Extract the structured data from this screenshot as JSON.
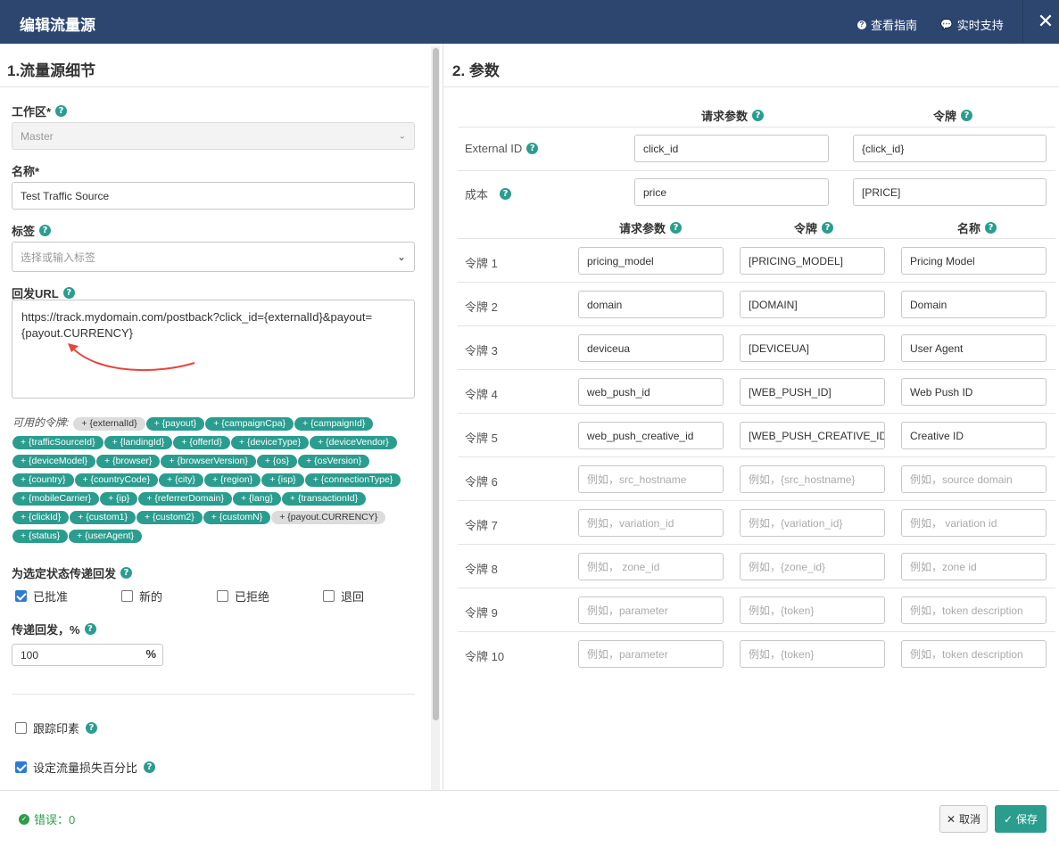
{
  "header": {
    "title": "编辑流量源",
    "guide_label": "查看指南",
    "support_label": "实时支持",
    "close_label": "✕"
  },
  "left": {
    "section_title": "1.流量源细节",
    "workspace": {
      "label": "工作区*",
      "value": "Master"
    },
    "name": {
      "label": "名称*",
      "value": "Test Traffic Source"
    },
    "tags": {
      "label": "标签",
      "placeholder": "选择或输入标签"
    },
    "postback": {
      "label": "回发URL",
      "line1": "https://track.mydomain.com/postback?click_id={externalId}&payout=",
      "line2": "{payout.CURRENCY}"
    },
    "tokens_label": "可用的令牌:",
    "tokens": [
      {
        "t": "+ {externalId}",
        "used": true
      },
      {
        "t": "+ {payout}"
      },
      {
        "t": "+ {campaignCpa}"
      },
      {
        "t": "+ {campaignId}"
      },
      {
        "t": "+ {trafficSourceId}"
      },
      {
        "t": "+ {landingId}"
      },
      {
        "t": "+ {offerId}"
      },
      {
        "t": "+ {deviceType}"
      },
      {
        "t": "+ {deviceVendor}"
      },
      {
        "t": "+ {deviceModel}"
      },
      {
        "t": "+ {browser}"
      },
      {
        "t": "+ {browserVersion}"
      },
      {
        "t": "+ {os}"
      },
      {
        "t": "+ {osVersion}"
      },
      {
        "t": "+ {country}"
      },
      {
        "t": "+ {countryCode}"
      },
      {
        "t": "+ {city}"
      },
      {
        "t": "+ {region}"
      },
      {
        "t": "+ {isp}"
      },
      {
        "t": "+ {connectionType}"
      },
      {
        "t": "+ {mobileCarrier}"
      },
      {
        "t": "+ {ip}"
      },
      {
        "t": "+ {referrerDomain}"
      },
      {
        "t": "+ {lang}"
      },
      {
        "t": "+ {transactionId}"
      },
      {
        "t": "+ {clickId}"
      },
      {
        "t": "+ {custom1}"
      },
      {
        "t": "+ {custom2}"
      },
      {
        "t": "+ {customN}"
      },
      {
        "t": "+ {payout.CURRENCY}",
        "used": true
      },
      {
        "t": "+ {status}"
      },
      {
        "t": "+ {userAgent}"
      }
    ],
    "status_label": "为选定状态传递回发",
    "statuses": [
      {
        "label": "已批准",
        "checked": true
      },
      {
        "label": "新的",
        "checked": false
      },
      {
        "label": "已拒绝",
        "checked": false
      },
      {
        "label": "退回",
        "checked": false
      }
    ],
    "pass_label": "传递回发，%",
    "pass_value": "100",
    "pass_unit": "%",
    "impression_label": "跟踪印素",
    "loss_label": "设定流量损失百分比"
  },
  "right": {
    "section_title": "2. 参数",
    "col_req": "请求参数",
    "col_token": "令牌",
    "col_name": "名称",
    "top_rows": [
      {
        "label": "External ID",
        "param": "click_id",
        "token": "{click_id}"
      },
      {
        "label": "成本",
        "param": "price",
        "token": "[PRICE]"
      }
    ],
    "rows": [
      {
        "label": "令牌 1",
        "param": "pricing_model",
        "token": "[PRICING_MODEL]",
        "name": "Pricing Model",
        "ph": false
      },
      {
        "label": "令牌 2",
        "param": "domain",
        "token": "[DOMAIN]",
        "name": "Domain",
        "ph": false
      },
      {
        "label": "令牌 3",
        "param": "deviceua",
        "token": "[DEVICEUA]",
        "name": "User Agent",
        "ph": false
      },
      {
        "label": "令牌 4",
        "param": "web_push_id",
        "token": "[WEB_PUSH_ID]",
        "name": "Web Push ID",
        "ph": false
      },
      {
        "label": "令牌 5",
        "param": "web_push_creative_id",
        "token": "[WEB_PUSH_CREATIVE_ID]",
        "name": "Creative ID",
        "ph": false
      },
      {
        "label": "令牌 6",
        "param": "例如，src_hostname",
        "token": "例如，{src_hostname}",
        "name": "例如，source domain",
        "ph": true
      },
      {
        "label": "令牌 7",
        "param": "例如，variation_id",
        "token": "例如，{variation_id}",
        "name": "例如， variation id",
        "ph": true
      },
      {
        "label": "令牌 8",
        "param": "例如， zone_id",
        "token": "例如，{zone_id}",
        "name": "例如，zone id",
        "ph": true
      },
      {
        "label": "令牌 9",
        "param": "例如，parameter",
        "token": "例如，{token}",
        "name": "例如，token description",
        "ph": true
      },
      {
        "label": "令牌 10",
        "param": "例如，parameter",
        "token": "例如，{token}",
        "name": "例如，token description",
        "ph": true
      }
    ]
  },
  "footer": {
    "errors_label": "错误：0",
    "cancel_label": "取消",
    "save_label": "保存"
  },
  "colors": {
    "header": "#2c4670",
    "accent": "#2a9d8f",
    "checkbox": "#2e7bd6",
    "annotation_arrow": "#e8453c"
  }
}
